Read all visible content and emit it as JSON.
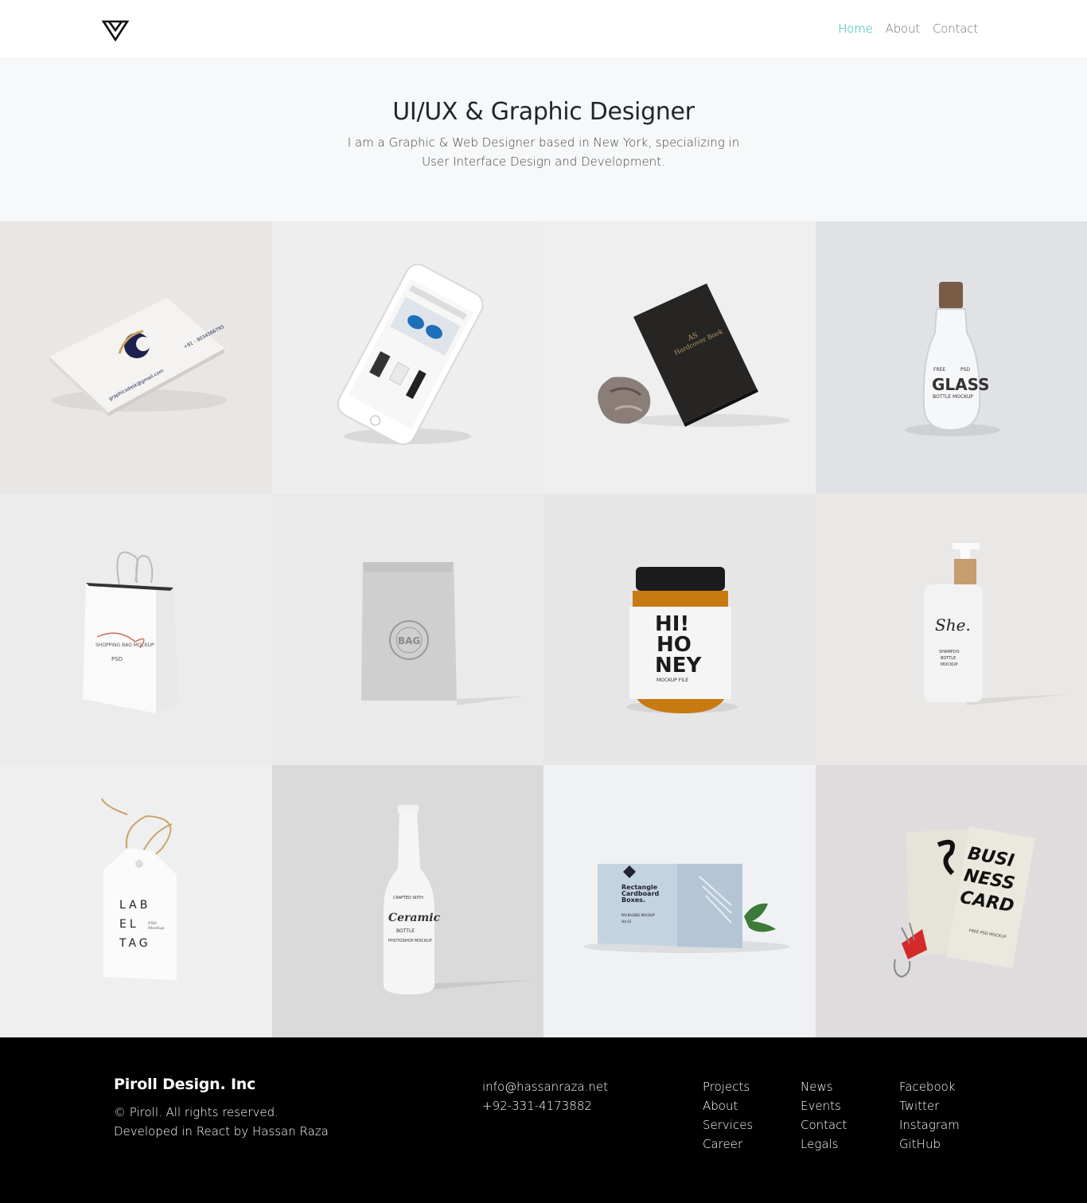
{
  "nav": {
    "links": [
      "Home",
      "About",
      "Contact"
    ],
    "active_color": "#1ab3a8"
  },
  "hero": {
    "title": "UI/UX & Graphic Designer",
    "subtitle": "I am a Graphic & Web Designer based in New York, specializing in User Interface Design and Development."
  },
  "portfolio": {
    "items": [
      {
        "icon": "business-card-mockup",
        "bg": "#e8e7e5"
      },
      {
        "icon": "phone-mockup",
        "bg": "#eeeeee"
      },
      {
        "icon": "hardcover-book-mockup",
        "bg": "#efefef"
      },
      {
        "icon": "glass-bottle-mockup",
        "bg": "#e1e2e6"
      },
      {
        "icon": "shopping-bag-mockup",
        "bg": "#ececec"
      },
      {
        "icon": "paper-bag-mockup",
        "bg": "#eaeaea"
      },
      {
        "icon": "honey-jar-mockup",
        "bg": "#e6e6e6"
      },
      {
        "icon": "shampoo-bottle-mockup",
        "bg": "#e9e8e6"
      },
      {
        "icon": "label-tag-mockup",
        "bg": "#efefef"
      },
      {
        "icon": "ceramic-bottle-mockup",
        "bg": "#dadadb"
      },
      {
        "icon": "cardboard-box-mockup",
        "bg": "#f0f1f3"
      },
      {
        "icon": "business-card-clip-mockup",
        "bg": "#dedcdc"
      }
    ],
    "labels": {
      "card_phone": "+91 - 9034566765",
      "card_email": "graphicsdesk@gmail.com",
      "book_mark": "AS",
      "book_title": "Hardcover Book",
      "glass_free": "FREE",
      "glass_psd": "PSD",
      "glass_title": "GLASS",
      "glass_sub": "BOTTLE MOCKUP",
      "bag_text": "SHOPPING BAG MOCKUP",
      "bag_psd": "PSD",
      "paper_bag": "BAG",
      "honey_1": "HI!",
      "honey_2": "HO",
      "honey_3": "NEY",
      "honey_sub": "MOCKUP FILE",
      "shampoo_brand": "She.",
      "shampoo_sub_1": "SHAMPOO",
      "shampoo_sub_2": "BOTTLE",
      "shampoo_sub_3": "MOCKUP",
      "tag_1": "LAB",
      "tag_2": "EL",
      "tag_3": "TAG",
      "tag_psd": "PSD",
      "tag_mockup": "Mockup",
      "ceramic_top": "CRAFTED WITH",
      "ceramic_name": "Ceramic",
      "ceramic_bottle": "BOTTLE",
      "ceramic_sub": "PHOTOSHOP MOCKUP",
      "box_title_1": "Rectangle",
      "box_title_2": "Cardboard",
      "box_title_3": "Boxes.",
      "box_sub": "PACKAGING MOCKUP",
      "box_vol": "Vol.03",
      "card_busi": "BUSI",
      "card_ness": "NESS",
      "card_card": "CARD",
      "card_free": "FREE PSD MOCKUP"
    }
  },
  "footer": {
    "brand": "Piroll Design. Inc",
    "copyright": "© Piroll. All rights reserved.",
    "developer": "Developed in React by Hassan Raza",
    "email": "info@hassanraza.net",
    "phone": "+92-331-4173882",
    "col1": [
      "Projects",
      "About",
      "Services",
      "Career"
    ],
    "col2": [
      "News",
      "Events",
      "Contact",
      "Legals"
    ],
    "col3": [
      "Facebook",
      "Twitter",
      "Instagram",
      "GitHub"
    ]
  }
}
